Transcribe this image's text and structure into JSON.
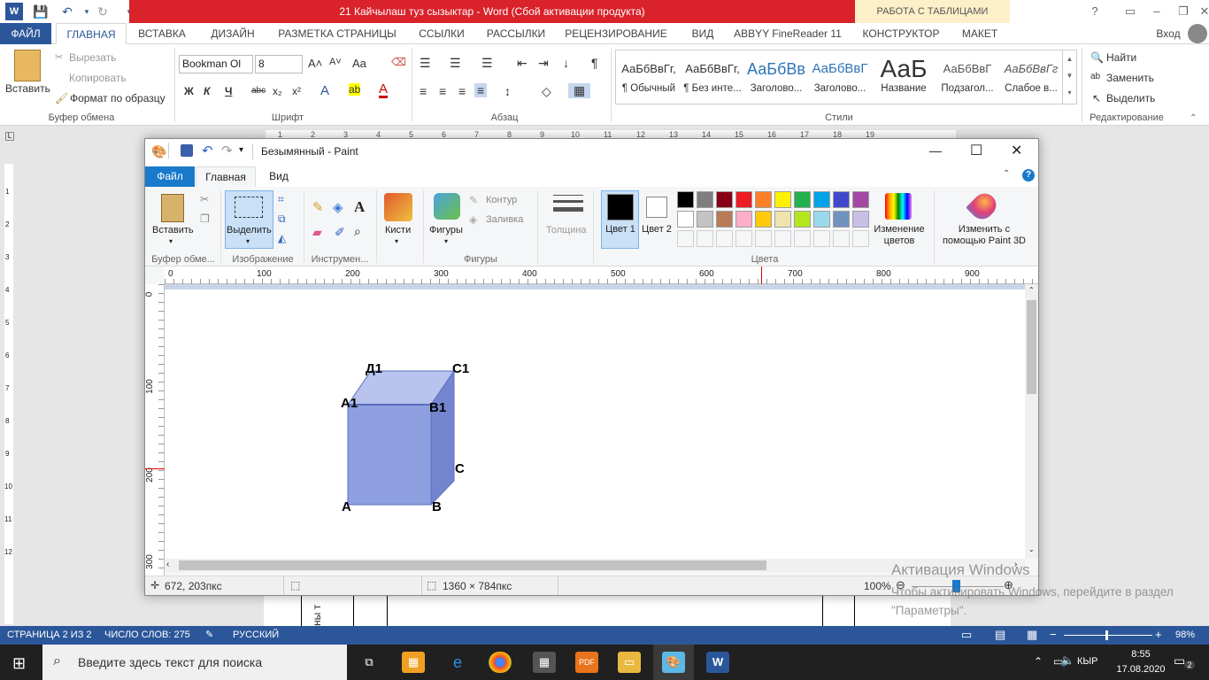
{
  "word": {
    "title": "21 Кайчылаш  туз сызыктар - Word (Сбой активации продукта)",
    "context_tab": "РАБОТА С ТАБЛИЦАМИ",
    "signin": "Вход",
    "tabs": [
      "ФАЙЛ",
      "ГЛАВНАЯ",
      "ВСТАВКА",
      "ДИЗАЙН",
      "РАЗМЕТКА СТРАНИЦЫ",
      "ССЫЛКИ",
      "РАССЫЛКИ",
      "РЕЦЕНЗИРОВАНИЕ",
      "ВИД",
      "ABBYY FineReader 11",
      "КОНСТРУКТОР",
      "МАКЕТ"
    ],
    "clipboard": {
      "paste": "Вставить",
      "cut": "Вырезать",
      "copy": "Копировать",
      "format_painter": "Формат по образцу",
      "label": "Буфер обмена"
    },
    "font": {
      "name": "Bookman Ol",
      "size": "8",
      "label": "Шрифт",
      "bold": "Ж",
      "italic": "К",
      "underline": "Ч",
      "strike": "abc",
      "sub": "x₂",
      "sup": "x²",
      "grow": "A˄",
      "shrink": "A˅",
      "case": "Aa"
    },
    "paragraph": {
      "label": "Абзац"
    },
    "styles": {
      "label": "Стили",
      "items": [
        {
          "preview": "АаБбВвГг,",
          "name": "¶ Обычный"
        },
        {
          "preview": "АаБбВвГг,",
          "name": "¶ Без инте..."
        },
        {
          "preview": "АаБбВв",
          "name": "Заголово..."
        },
        {
          "preview": "АаБбВвГ",
          "name": "Заголово..."
        },
        {
          "preview": "АаБ",
          "name": "Название"
        },
        {
          "preview": "АаБбВвГ",
          "name": "Подзагол..."
        },
        {
          "preview": "АаБбВвГг",
          "name": "Слабое в..."
        }
      ]
    },
    "editing": {
      "find": "Найти",
      "replace": "Заменить",
      "select": "Выделить",
      "label": "Редактирование"
    },
    "ruler_numbers": [
      "1",
      "2",
      "3",
      "4",
      "5",
      "6",
      "7",
      "8",
      "9",
      "10",
      "11",
      "12",
      "13",
      "14",
      "15",
      "16",
      "17",
      "18",
      "19"
    ],
    "left_ruler_numbers": [
      "1",
      "2",
      "3",
      "4",
      "5",
      "6",
      "7",
      "8",
      "9",
      "10",
      "11",
      "12"
    ],
    "status": {
      "page": "СТРАНИЦА 2 ИЗ 2",
      "words": "ЧИСЛО СЛОВ: 275",
      "lang": "РУССКИЙ",
      "zoom": "98%"
    },
    "page_fragment_text": "ны т"
  },
  "paint": {
    "title": "Безымянный - Paint",
    "tabs": [
      "Файл",
      "Главная",
      "Вид"
    ],
    "clipboard": {
      "paste": "Вставить",
      "label": "Буфер обме..."
    },
    "image": {
      "select": "Выделить",
      "label": "Изображение"
    },
    "tools": {
      "label": "Инструмен..."
    },
    "brushes": "Кисти",
    "shapes": {
      "shapes": "Фигуры",
      "outline": "Контур",
      "fill": "Заливка",
      "label": "Фигуры"
    },
    "size": "Толщина",
    "color1": "Цвет 1",
    "color2": "Цвет 2",
    "edit_colors": "Изменение цветов",
    "paint3d": "Изменить с помощью Paint 3D",
    "colors_label": "Цвета",
    "palette_row1": [
      "#000000",
      "#7f7f7f",
      "#880015",
      "#ed1c24",
      "#ff7f27",
      "#fff200",
      "#22b14c",
      "#00a2e8",
      "#3f48cc",
      "#a349a4"
    ],
    "palette_row2": [
      "#ffffff",
      "#c3c3c3",
      "#b97a57",
      "#ffaec9",
      "#ffc90e",
      "#efe4b0",
      "#b5e61d",
      "#99d9ea",
      "#7092be",
      "#c8bfe7"
    ],
    "ruler_top": [
      "0",
      "100",
      "200",
      "300",
      "400",
      "500",
      "600",
      "700",
      "800",
      "900"
    ],
    "ruler_left": [
      "0",
      "100",
      "200",
      "300"
    ],
    "cube_labels": {
      "A": "A",
      "B": "B",
      "C": "C",
      "A1": "A1",
      "B1": "B1",
      "C1": "C1",
      "D1": "Д1"
    },
    "cube_colors": {
      "front": "#8e9fe0",
      "top": "#b8c3ee",
      "side": "#7385cf",
      "edge": "#5a6ec0"
    },
    "status": {
      "cursor": "672, 203пкс",
      "size": "1360 × 784пкс",
      "zoom": "100%"
    }
  },
  "watermark": {
    "line1": "Активация Windows",
    "line2": "Чтобы активировать Windows, перейдите в раздел \"Параметры\"."
  },
  "taskbar": {
    "search": "Введите здесь текст для поиска",
    "lang": "КЫР",
    "time": "8:55",
    "date": "17.08.2020",
    "notif_count": "2"
  }
}
